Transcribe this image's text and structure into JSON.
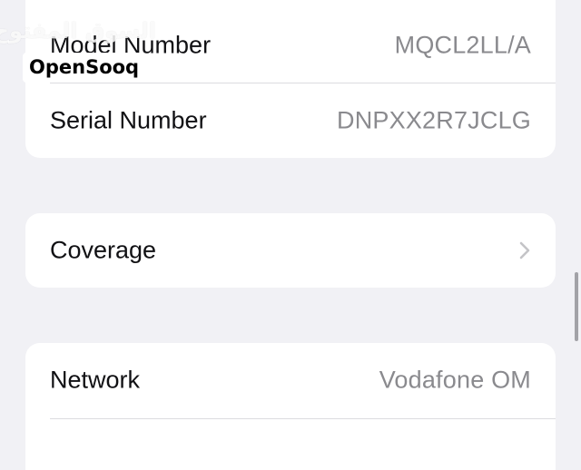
{
  "about": {
    "rows": [
      {
        "label": "Model Number",
        "value": "MQCL2LL/A"
      },
      {
        "label": "Serial Number",
        "value": "DNPXX2R7JCLG"
      }
    ]
  },
  "coverage": {
    "label": "Coverage",
    "icon": "chevron-right-icon"
  },
  "network": {
    "label": "Network",
    "value": "Vodafone OM"
  },
  "watermark": {
    "arabic": "السوق المفتوح",
    "brand": "OpenSooq"
  },
  "colors": {
    "background": "#f1f1f5",
    "card": "#ffffff",
    "label_text": "#111114",
    "value_text": "#8a8a8e",
    "separator": "#dcdce0"
  }
}
